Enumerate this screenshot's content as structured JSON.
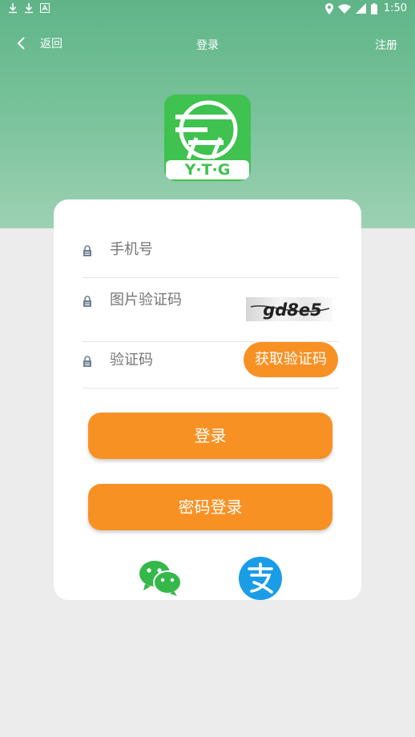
{
  "status_bar": {
    "time": "1:50"
  },
  "nav": {
    "back_label": "返回",
    "title": "登录",
    "register_label": "注册"
  },
  "logo": {
    "text": "Y·T·G"
  },
  "form": {
    "phone_placeholder": "手机号",
    "image_code_placeholder": "图片验证码",
    "captcha_text": "gd8e5",
    "sms_code_placeholder": "验证码",
    "get_code_label": "获取验证码"
  },
  "actions": {
    "login_label": "登录",
    "password_login_label": "密码登录"
  },
  "social": [
    "wechat-icon",
    "alipay-icon"
  ],
  "colors": {
    "accent": "#f89124",
    "header": "#6cbc92",
    "logo_bg": "#3fc24f"
  }
}
